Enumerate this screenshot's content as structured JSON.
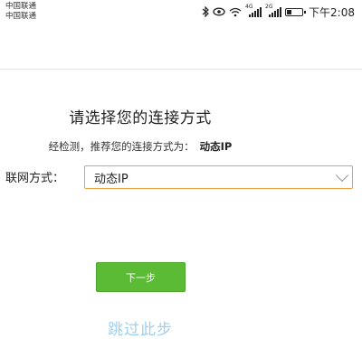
{
  "status_bar": {
    "carrier_1": "中国联通",
    "carrier_2": "中国联通",
    "signal_1_tag": "4G",
    "signal_2_tag": "2G",
    "battery_level": 0.35,
    "time": "下午2:08",
    "icons": [
      "bluetooth-icon",
      "eye-icon",
      "wifi-icon",
      "signal-icon",
      "signal-icon",
      "battery-icon"
    ]
  },
  "page": {
    "title": "请选择您的连接方式",
    "detect_prefix": "经检测，推荐您的连接方式为：",
    "detect_value": "动态IP"
  },
  "form": {
    "label": "联网方式：",
    "selected": "动态IP"
  },
  "actions": {
    "next_label": "下一步",
    "skip_label": "跳过此步"
  },
  "colors": {
    "accent_green": "#5bbb34",
    "select_border": "#f0a040",
    "skip_link": "#9dd0ef"
  }
}
